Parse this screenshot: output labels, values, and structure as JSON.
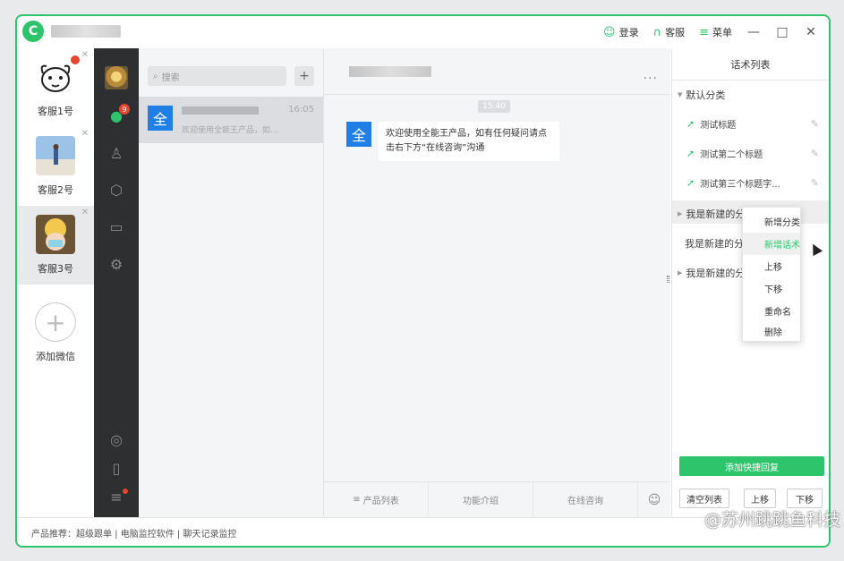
{
  "titlebar": {
    "logo_char": "C",
    "login": "登录",
    "service": "客服",
    "menu": "菜单",
    "min": "—",
    "max": "□",
    "close": "✕"
  },
  "accounts": [
    {
      "name": "客服1号"
    },
    {
      "name": "客服2号"
    },
    {
      "name": "客服3号"
    }
  ],
  "add_account_label": "添加微信",
  "nav": {
    "badge": "9"
  },
  "chatlist": {
    "search_placeholder": "搜索",
    "plus": "+",
    "item": {
      "avatar_char": "全",
      "time": "16:05",
      "preview": "欢迎使用全能王产品，如..."
    }
  },
  "conversation": {
    "more": "...",
    "timestamp": "15:40",
    "avatar_char": "全",
    "message": "欢迎使用全能王产品，如有任何疑问请点击右下方“在线咨询”沟通",
    "tabs": [
      "产品列表",
      "功能介绍",
      "在线咨询"
    ]
  },
  "panel": {
    "title": "话术列表",
    "category_default": "默认分类",
    "scripts": [
      "测试标题",
      "测试第二个标题",
      "测试第三个标题字..."
    ],
    "cat_new_1": "我是新建的分类",
    "cat_new_2": "我是新建的分",
    "cat_new_3": "我是新建的分",
    "add_button": "添加快捷回复",
    "clear_button": "清空列表",
    "up_button": "上移",
    "down_button": "下移"
  },
  "context_menu": [
    "新增分类",
    "新增话术",
    "上移",
    "下移",
    "重命名",
    "删除"
  ],
  "footer": "产品推荐：超级跟单 | 电脑监控软件 | 聊天记录监控",
  "watermark": "@苏州跳跳鱼科技",
  "colors": {
    "accent": "#2ec46c",
    "blue": "#1f7fe6",
    "nav_bg": "#2e2f31",
    "badge": "#e8452e"
  }
}
